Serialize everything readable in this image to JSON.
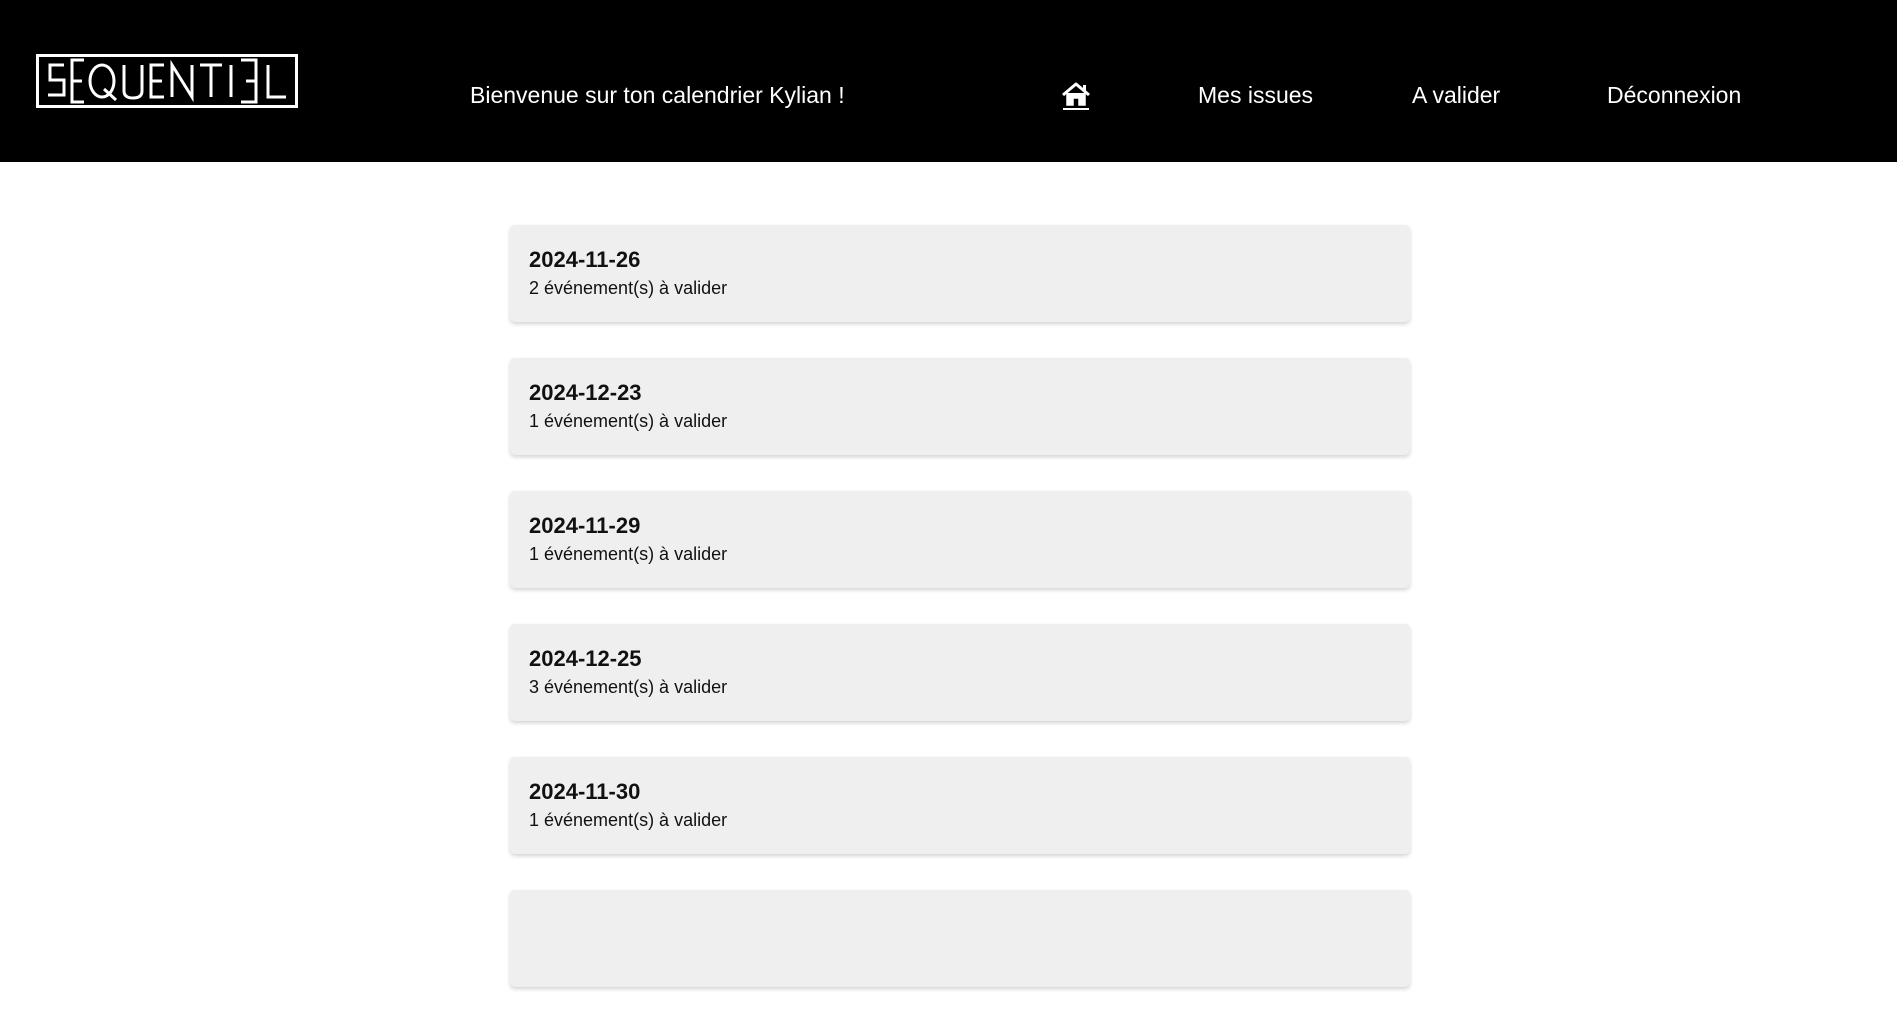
{
  "header": {
    "logo_text": "SEQUENTIEL",
    "welcome": "Bienvenue sur ton calendrier Kylian !",
    "nav": {
      "home_icon": "home-icon",
      "issues_label": "Mes issues",
      "validate_label": "A valider",
      "logout_label": "Déconnexion"
    }
  },
  "days": [
    {
      "date": "2024-11-26",
      "summary": "2 événement(s) à valider"
    },
    {
      "date": "2024-12-23",
      "summary": "1 événement(s) à valider"
    },
    {
      "date": "2024-11-29",
      "summary": "1 événement(s) à valider"
    },
    {
      "date": "2024-12-25",
      "summary": "3 événement(s) à valider"
    },
    {
      "date": "2024-11-30",
      "summary": "1 événement(s) à valider"
    }
  ],
  "colors": {
    "header_bg": "#000000",
    "card_bg": "#efefef",
    "text": "#111111"
  }
}
